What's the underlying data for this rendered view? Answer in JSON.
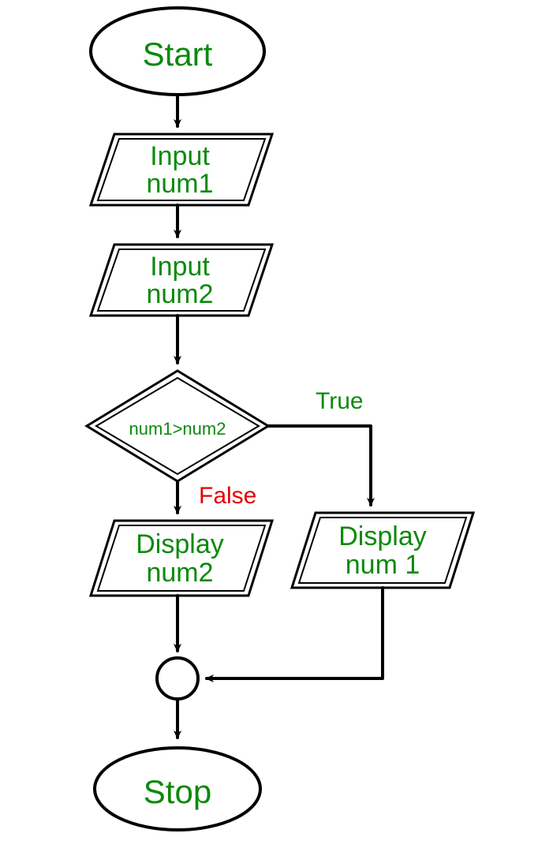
{
  "flowchart": {
    "start": "Start",
    "input1_line1": "Input",
    "input1_line2": "num1",
    "input2_line1": "Input",
    "input2_line2": "num2",
    "decision": "num1>num2",
    "decision_true": "True",
    "decision_false": "False",
    "display_false_line1": "Display",
    "display_false_line2": "num2",
    "display_true_line1": "Display",
    "display_true_line2": "num 1",
    "stop": "Stop"
  }
}
